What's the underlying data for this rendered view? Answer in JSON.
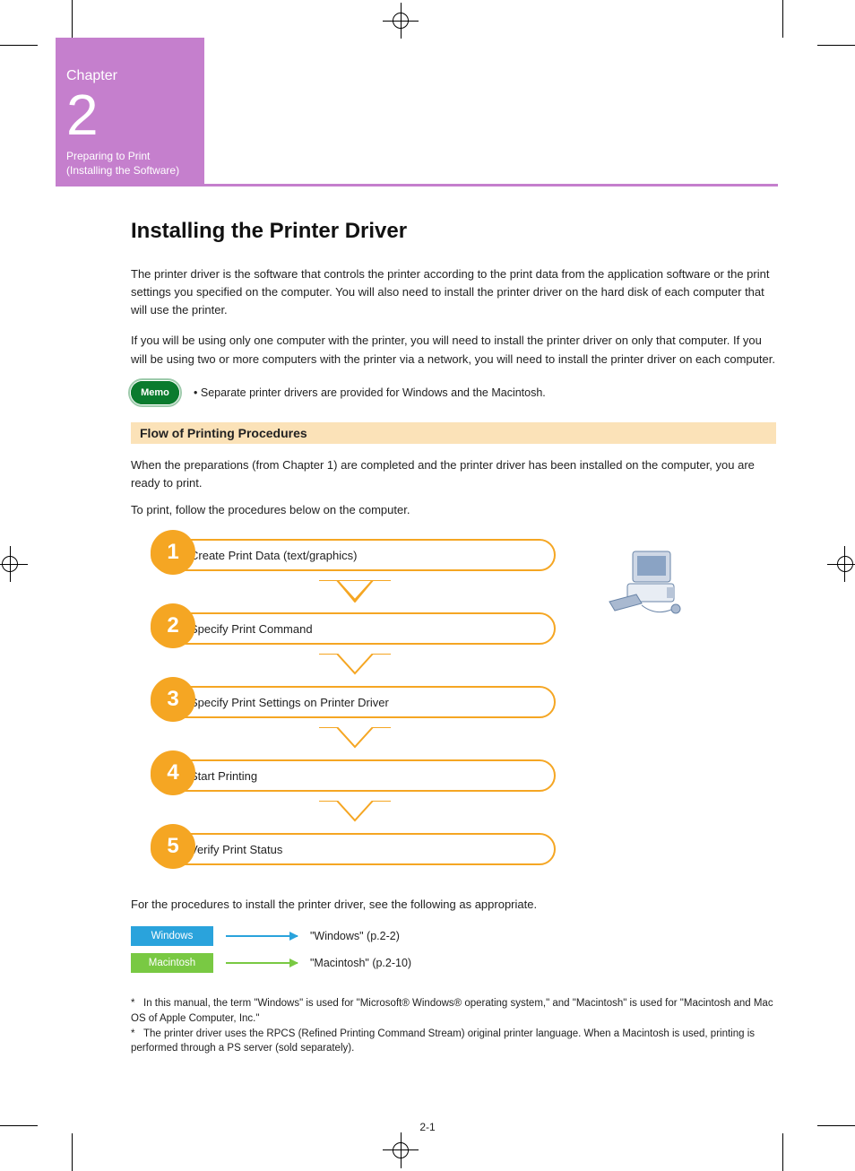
{
  "chapter": {
    "label": "Chapter",
    "number": "2",
    "title_line1": "Preparing to Print",
    "title_line2": "(Installing the Software)"
  },
  "h1": "Installing the Printer Driver",
  "intro_para1": "The printer driver is the software that controls the printer according to the print data from the application software or the print settings you specified on the computer. You will also need to install the printer driver on the hard disk of each computer that will use the printer.",
  "intro_para2": "If you will be using only one computer with the printer, you will need to install the printer driver on only that computer. If you will be using two or more computers with the printer via a network, you will need to install the printer driver on each computer.",
  "memo": {
    "badge": "Memo",
    "text": "Separate printer drivers are provided for Windows and the Macintosh."
  },
  "section_title": "Flow of Printing Procedures",
  "section_para1": "When the preparations (from Chapter 1) are completed and the printer driver has been installed on the computer, you are ready to print.",
  "section_para2": "To print, follow the procedures below on the computer.",
  "steps": [
    {
      "n": "1",
      "label": "Create Print Data (text/graphics)"
    },
    {
      "n": "2",
      "label": "Specify Print Command"
    },
    {
      "n": "3",
      "label": "Specify Print Settings on Printer Driver"
    },
    {
      "n": "4",
      "label": "Start Printing"
    },
    {
      "n": "5",
      "label": "Verify Print Status"
    }
  ],
  "refs_intro": "For the procedures to install the printer driver, see the following as appropriate.",
  "refs": [
    {
      "chip": "Windows",
      "chip_class": "blue",
      "target": "\"Windows\" (p.2-2)"
    },
    {
      "chip": "Macintosh",
      "chip_class": "green",
      "target": "\"Macintosh\" (p.2-10)"
    }
  ],
  "note_line1": "In this manual, the term \"Windows\" is used for \"Microsoft® Windows® operating system,\" and \"Macintosh\" is used for \"Macintosh and Mac OS of Apple Computer, Inc.\"",
  "note_line2": "The printer driver uses the RPCS (Refined Printing Command Stream) original printer language. When a Macintosh is used, printing is performed through a PS server (sold separately).",
  "page_number": "2-1"
}
